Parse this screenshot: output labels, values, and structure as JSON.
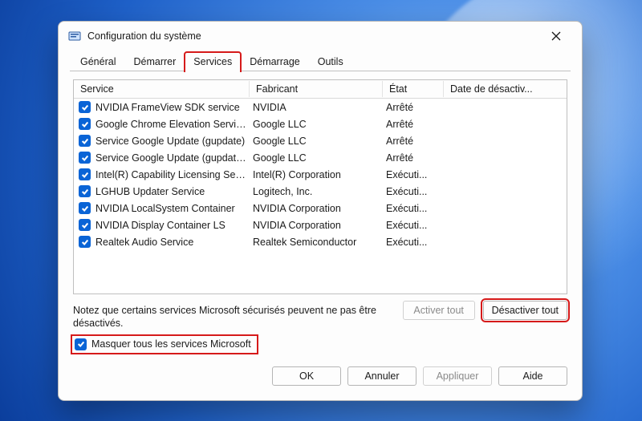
{
  "window": {
    "title": "Configuration du système"
  },
  "tabs": {
    "general": "Général",
    "startup": "Démarrer",
    "services": "Services",
    "boot": "Démarrage",
    "tools": "Outils"
  },
  "columns": {
    "service": "Service",
    "fabricant": "Fabricant",
    "etat": "État",
    "date": "Date de désactiv..."
  },
  "services": [
    {
      "name": "NVIDIA FrameView SDK service",
      "vendor": "NVIDIA",
      "state": "Arrêté",
      "date": ""
    },
    {
      "name": "Google Chrome Elevation Servic...",
      "vendor": "Google LLC",
      "state": "Arrêté",
      "date": ""
    },
    {
      "name": "Service Google Update (gupdate)",
      "vendor": "Google LLC",
      "state": "Arrêté",
      "date": ""
    },
    {
      "name": "Service Google Update (gupdate...",
      "vendor": "Google LLC",
      "state": "Arrêté",
      "date": ""
    },
    {
      "name": "Intel(R) Capability Licensing Ser...",
      "vendor": "Intel(R) Corporation",
      "state": "Exécuti...",
      "date": ""
    },
    {
      "name": "LGHUB Updater Service",
      "vendor": "Logitech, Inc.",
      "state": "Exécuti...",
      "date": ""
    },
    {
      "name": "NVIDIA LocalSystem Container",
      "vendor": "NVIDIA Corporation",
      "state": "Exécuti...",
      "date": ""
    },
    {
      "name": "NVIDIA Display Container LS",
      "vendor": "NVIDIA Corporation",
      "state": "Exécuti...",
      "date": ""
    },
    {
      "name": "Realtek Audio Service",
      "vendor": "Realtek Semiconductor",
      "state": "Exécuti...",
      "date": ""
    }
  ],
  "note": "Notez que certains services Microsoft sécurisés peuvent ne pas être désactivés.",
  "buttons": {
    "enable_all": "Activer tout",
    "disable_all": "Désactiver tout",
    "ok": "OK",
    "cancel": "Annuler",
    "apply": "Appliquer",
    "help": "Aide"
  },
  "hide_ms_label": "Masquer tous les services Microsoft"
}
